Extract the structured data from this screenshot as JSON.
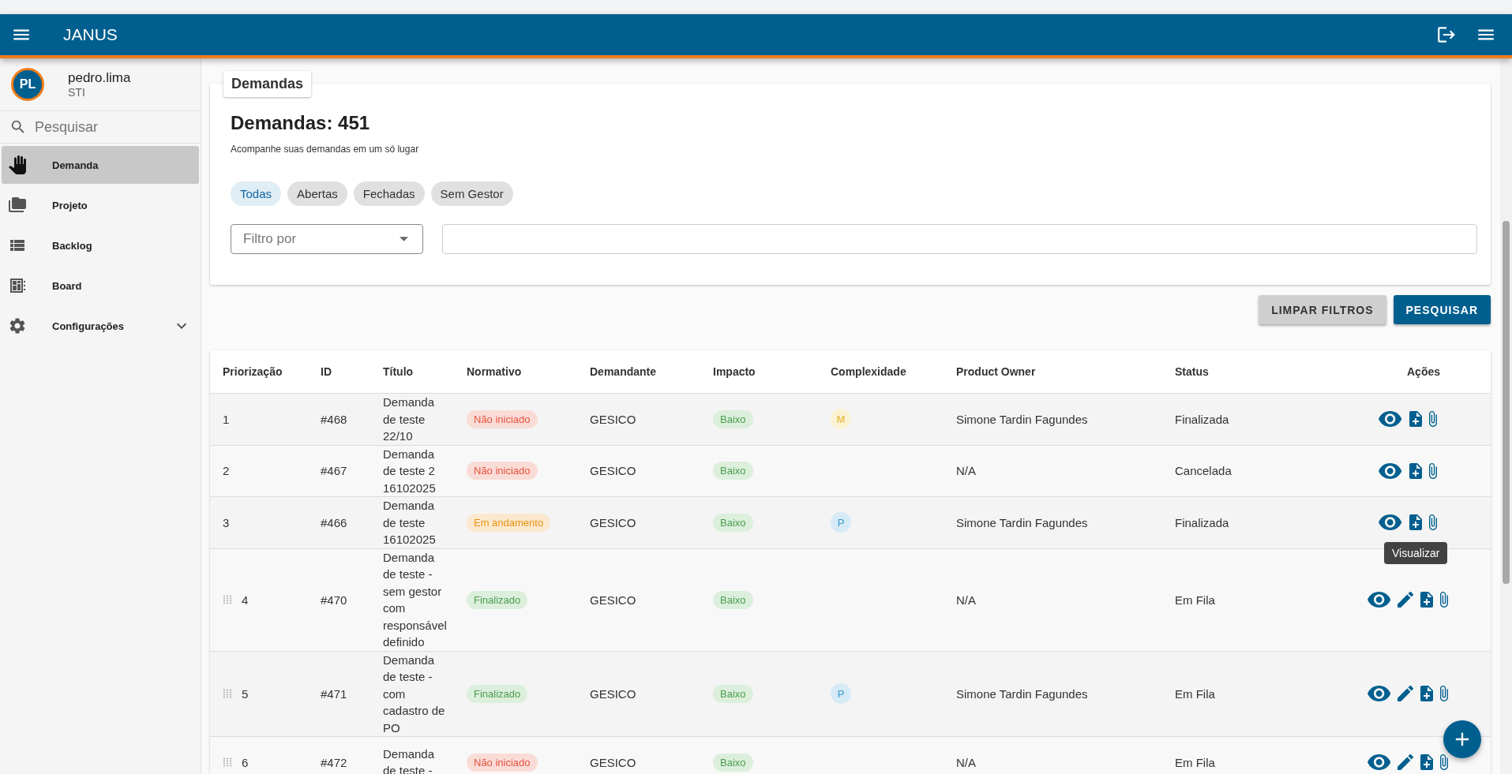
{
  "app_bar": {
    "title": "JANUS"
  },
  "sidebar": {
    "user": {
      "initials": "PL",
      "name": "pedro.lima",
      "unit": "STI"
    },
    "search": {
      "placeholder": "Pesquisar"
    },
    "items": [
      {
        "label": "Demanda",
        "selected": true
      },
      {
        "label": "Projeto",
        "selected": false
      },
      {
        "label": "Backlog",
        "selected": false
      },
      {
        "label": "Board",
        "selected": false
      },
      {
        "label": "Configurações",
        "selected": false,
        "expanded": false
      }
    ]
  },
  "page_tab": "Demandas",
  "header": {
    "title": "Demandas: 451",
    "subtitle": "Acompanhe suas demandas em um só lugar"
  },
  "filter_chips": [
    {
      "label": "Todas",
      "selected": true
    },
    {
      "label": "Abertas",
      "selected": false
    },
    {
      "label": "Fechadas",
      "selected": false
    },
    {
      "label": "Sem Gestor",
      "selected": false
    }
  ],
  "filter": {
    "select_placeholder": "Filtro por"
  },
  "buttons": [
    {
      "label": "LIMPAR FILTROS",
      "kind": "secondary"
    },
    {
      "label": "PESQUISAR",
      "kind": "primary"
    }
  ],
  "table": {
    "columns": [
      "Priorização",
      "ID",
      "Título",
      "Normativo",
      "Demandante",
      "Impacto",
      "Complexidade",
      "Product Owner",
      "Status",
      "Ações"
    ],
    "rows": [
      {
        "draggable": false,
        "priority": "1",
        "id": "#468",
        "title": "Demanda de teste 22/10",
        "normativo": {
          "label": "Não iniciado",
          "kind": "not_started"
        },
        "demandante": "GESICO",
        "impacto": "Baixo",
        "complexidade": {
          "label": "M",
          "kind": "medium"
        },
        "product_owner": "Simone Tardin Fagundes",
        "status": "Finalizada",
        "editable": false
      },
      {
        "draggable": false,
        "priority": "2",
        "id": "#467",
        "title": "Demanda de teste 2 16102025",
        "normativo": {
          "label": "Não iniciado",
          "kind": "not_started"
        },
        "demandante": "GESICO",
        "impacto": "Baixo",
        "product_owner": "N/A",
        "status": "Cancelada",
        "editable": false
      },
      {
        "draggable": false,
        "priority": "3",
        "id": "#466",
        "title": "Demanda de teste 16102025",
        "normativo": {
          "label": "Em andamento",
          "kind": "in_progress"
        },
        "demandante": "GESICO",
        "impacto": "Baixo",
        "complexidade": {
          "label": "P",
          "kind": "small"
        },
        "product_owner": "Simone Tardin Fagundes",
        "status": "Finalizada",
        "editable": false,
        "tooltip": "Visualizar"
      },
      {
        "draggable": true,
        "priority": "4",
        "id": "#470",
        "title": "Demanda de teste - sem gestor com responsável definido",
        "normativo": {
          "label": "Finalizado",
          "kind": "done"
        },
        "demandante": "GESICO",
        "impacto": "Baixo",
        "product_owner": "N/A",
        "status": "Em Fila",
        "editable": true
      },
      {
        "draggable": true,
        "priority": "5",
        "id": "#471",
        "title": "Demanda de teste - com cadastro de PO",
        "normativo": {
          "label": "Finalizado",
          "kind": "done"
        },
        "demandante": "GESICO",
        "impacto": "Baixo",
        "complexidade": {
          "label": "P",
          "kind": "small"
        },
        "product_owner": "Simone Tardin Fagundes",
        "status": "Em Fila",
        "editable": true
      },
      {
        "draggable": true,
        "priority": "6",
        "id": "#472",
        "title": "Demanda de teste -",
        "normativo": {
          "label": "Não iniciado",
          "kind": "not_started"
        },
        "demandante": "GESICO",
        "impacto": "Baixo",
        "product_owner": "N/A",
        "status": "Em Fila",
        "editable": true
      }
    ]
  }
}
